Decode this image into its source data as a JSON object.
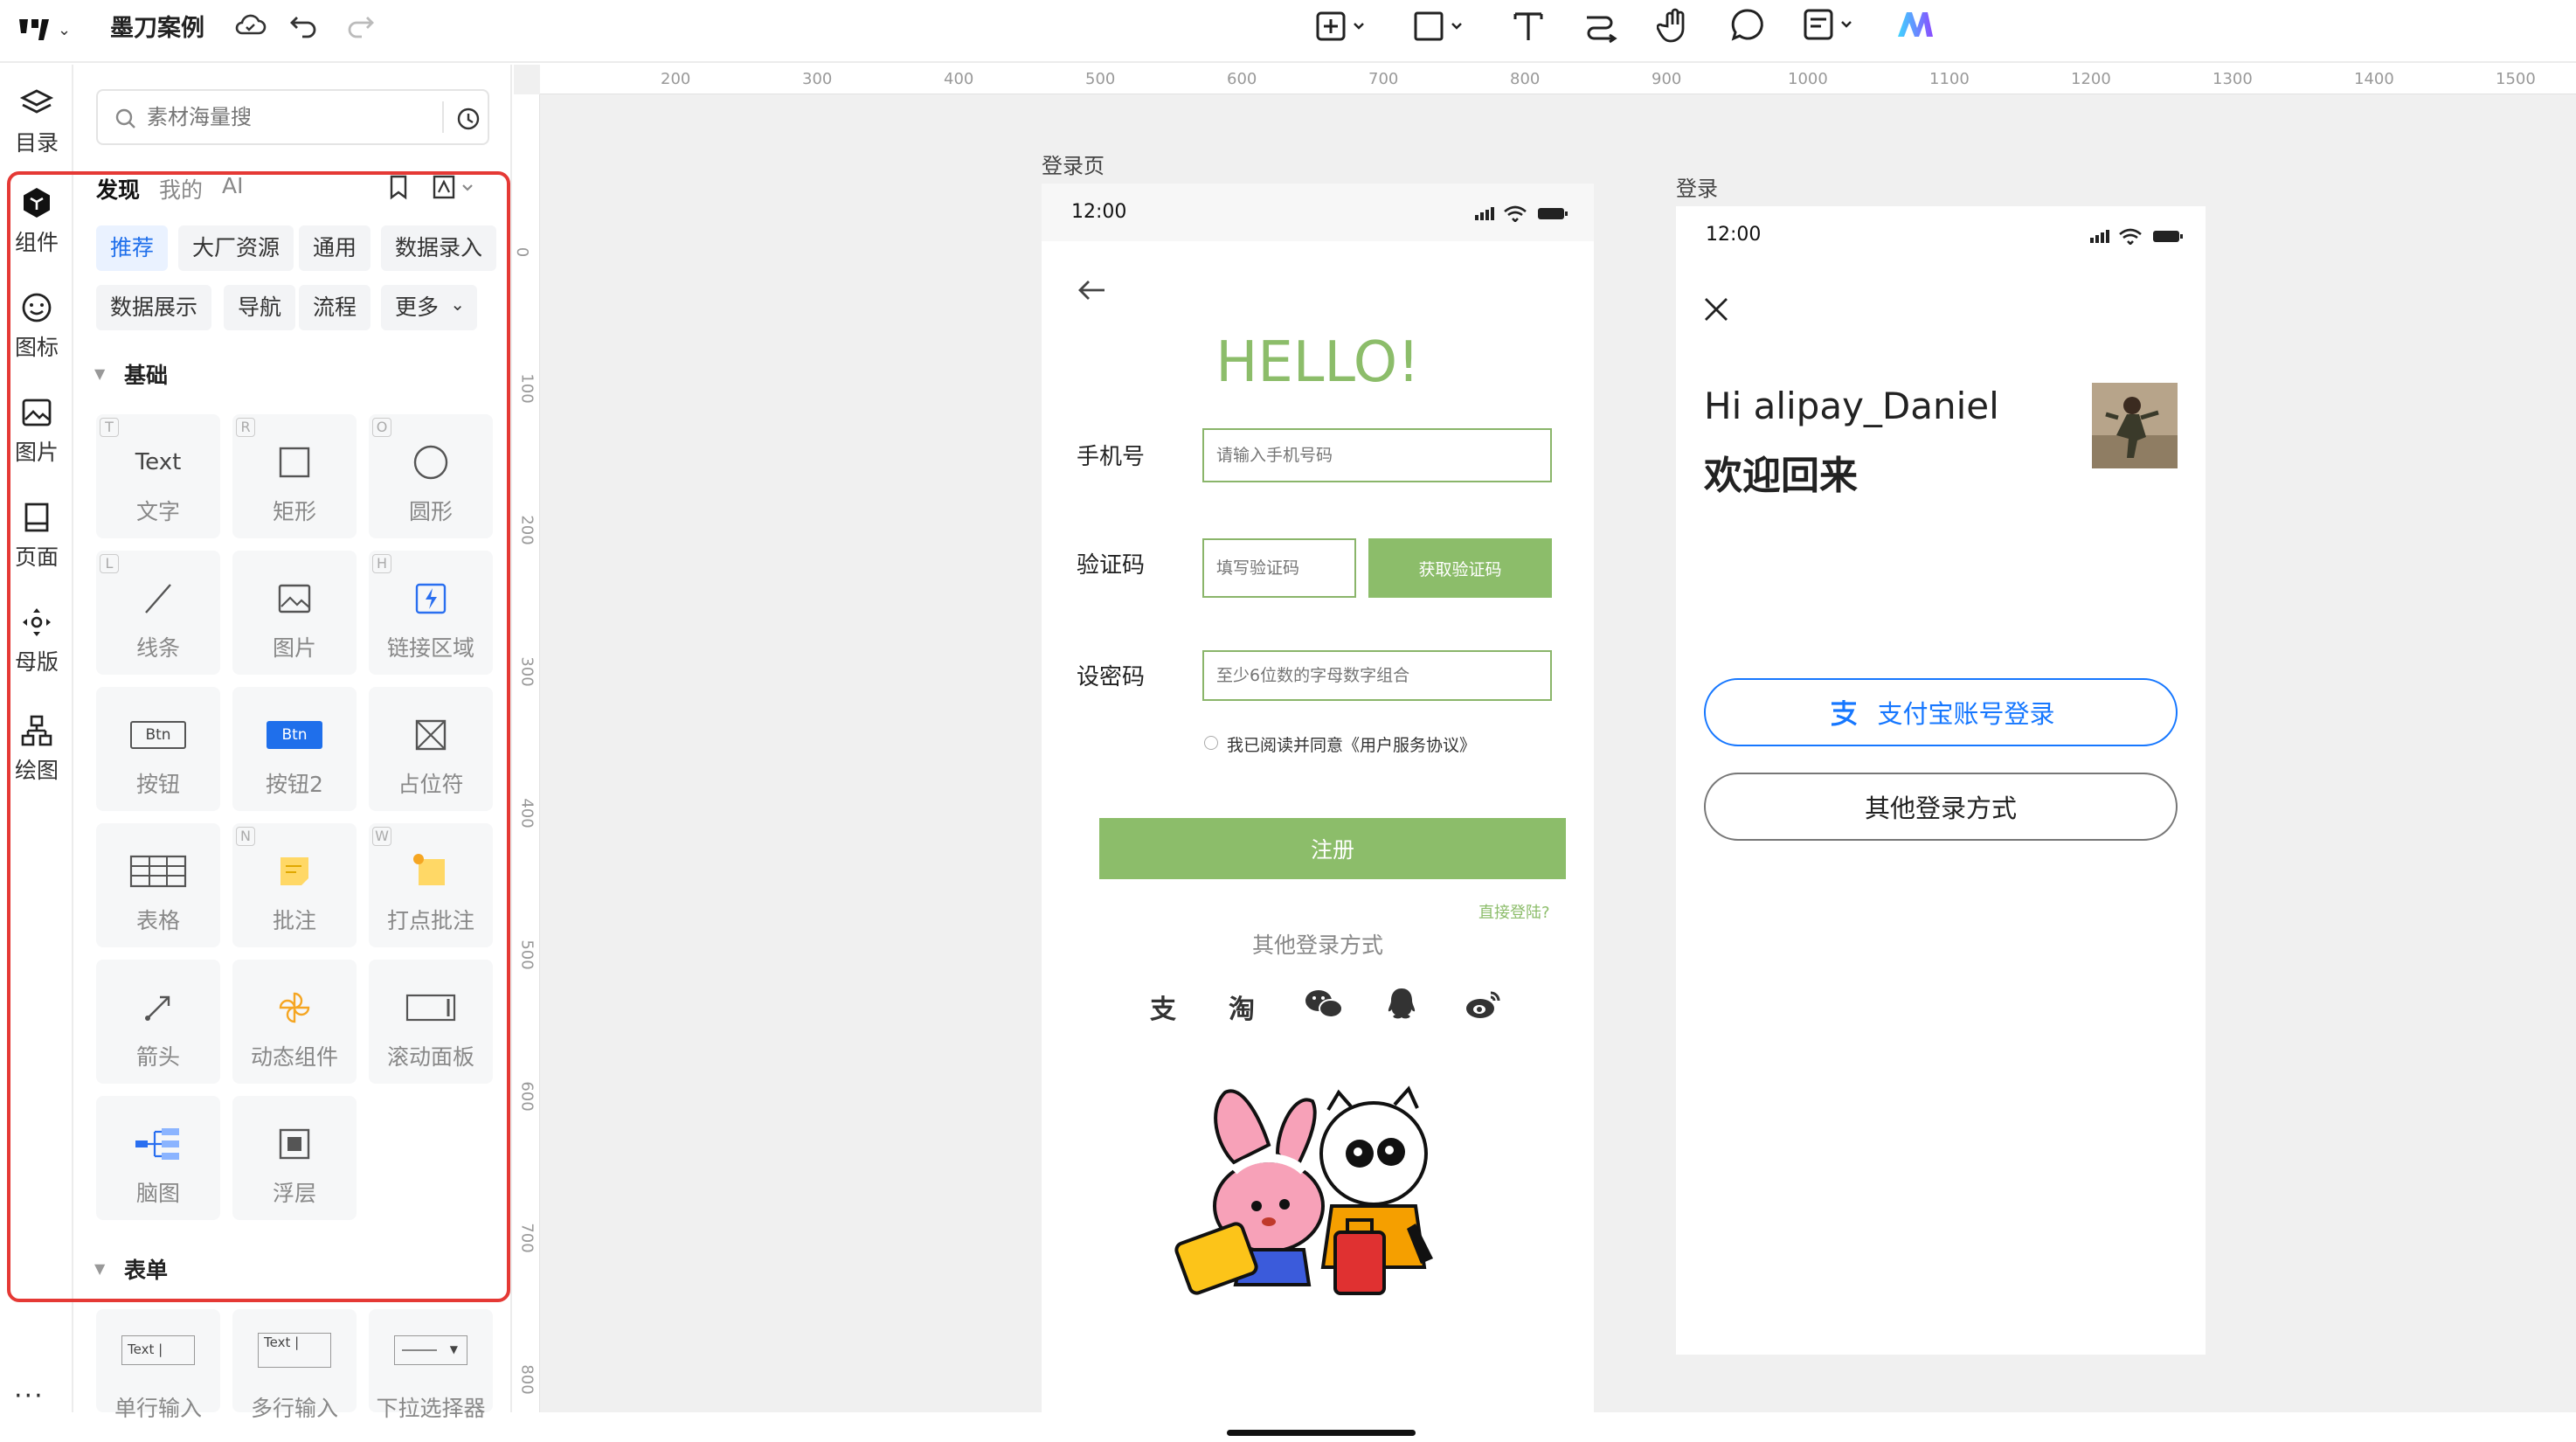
{
  "app": {
    "doc_title": "墨刀案例"
  },
  "toolbar": {
    "icons": [
      "insert-icon",
      "rectangle-icon",
      "text-icon",
      "connector-icon",
      "hand-icon",
      "comment-icon",
      "note-icon",
      "ai-icon"
    ]
  },
  "rail": {
    "items": [
      {
        "label": "目录",
        "icon": "layers-icon"
      },
      {
        "label": "组件",
        "icon": "component-icon"
      },
      {
        "label": "图标",
        "icon": "emoji-icon"
      },
      {
        "label": "图片",
        "icon": "image-icon"
      },
      {
        "label": "页面",
        "icon": "page-icon"
      },
      {
        "label": "母版",
        "icon": "master-icon"
      },
      {
        "label": "绘图",
        "icon": "diagram-icon"
      }
    ],
    "more": "···"
  },
  "panel": {
    "search_placeholder": "素材海量搜",
    "tabs": [
      "发现",
      "我的",
      "AI"
    ],
    "chips_row1": [
      "推荐",
      "大厂资源",
      "通用",
      "数据录入"
    ],
    "chips_row2": [
      "数据展示",
      "导航",
      "流程",
      "更多"
    ],
    "section_basic": "基础",
    "section_form": "表单",
    "basic_items": [
      {
        "label": "文字",
        "key": "T",
        "vis": "Text"
      },
      {
        "label": "矩形",
        "key": "R"
      },
      {
        "label": "圆形",
        "key": "O"
      },
      {
        "label": "线条",
        "key": "L"
      },
      {
        "label": "图片",
        "key": ""
      },
      {
        "label": "链接区域",
        "key": "H"
      },
      {
        "label": "按钮",
        "key": "",
        "vis": "Btn"
      },
      {
        "label": "按钮2",
        "key": "",
        "vis": "Btn"
      },
      {
        "label": "占位符",
        "key": ""
      },
      {
        "label": "表格",
        "key": ""
      },
      {
        "label": "批注",
        "key": "N"
      },
      {
        "label": "打点批注",
        "key": "W"
      },
      {
        "label": "箭头",
        "key": ""
      },
      {
        "label": "动态组件",
        "key": ""
      },
      {
        "label": "滚动面板",
        "key": ""
      },
      {
        "label": "脑图",
        "key": ""
      },
      {
        "label": "浮层",
        "key": ""
      }
    ],
    "form_items": [
      {
        "label": "单行输入",
        "vis": "Text |"
      },
      {
        "label": "多行输入",
        "vis": "Text |"
      },
      {
        "label": "下拉选择器",
        "vis": ""
      }
    ],
    "highlight_color": "#e53935"
  },
  "ruler": {
    "x_ticks": [
      "200",
      "300",
      "400",
      "500",
      "600",
      "700",
      "800",
      "900",
      "1000",
      "1100",
      "1200",
      "1300",
      "1400",
      "1500"
    ],
    "y_ticks": [
      "0",
      "100",
      "200",
      "300",
      "400",
      "500",
      "600",
      "700",
      "800"
    ]
  },
  "artboard1": {
    "name": "登录页",
    "time": "12:00",
    "hello": "HELLO!",
    "phone_label": "手机号",
    "phone_placeholder": "请输入手机号码",
    "code_label": "验证码",
    "code_placeholder": "填写验证码",
    "get_code": "获取验证码",
    "pwd_label": "设密码",
    "pwd_placeholder": "至少6位数的字母数字组合",
    "agree": "我已阅读并同意《用户服务协议》",
    "register": "注册",
    "direct_login": "直接登陆?",
    "other_login": "其他登录方式",
    "social": [
      "支",
      "淘",
      "微",
      "企",
      "微博"
    ],
    "accent": "#8cbd6a"
  },
  "artboard2": {
    "name": "登录",
    "time": "12:00",
    "greeting": "Hi alipay_Daniel",
    "welcome": "欢迎回来",
    "alipay_button": "支付宝账号登录",
    "other_button": "其他登录方式",
    "alipay_color": "#1677ff"
  }
}
